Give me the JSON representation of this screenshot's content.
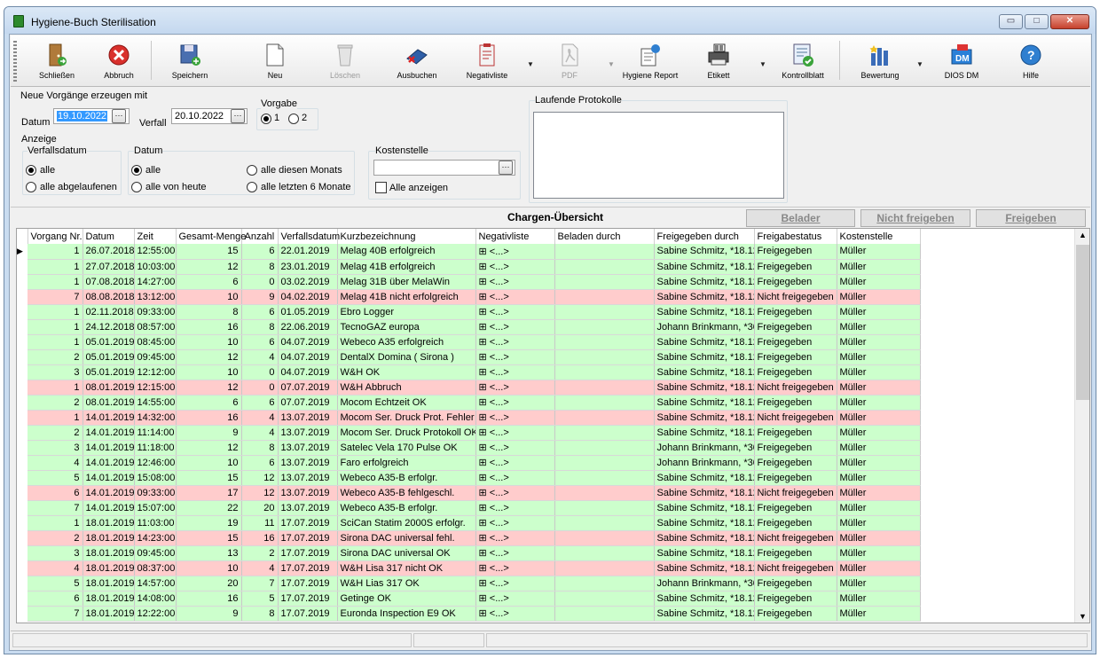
{
  "window": {
    "title": "Hygiene-Buch Sterilisation"
  },
  "toolbar": [
    {
      "label": "Schließen",
      "icon": "door-exit-icon",
      "x": "tb1"
    },
    {
      "label": "Abbruch",
      "icon": "cancel-icon"
    },
    {
      "label": "Speichern",
      "icon": "save-icon"
    },
    {
      "label": "Neu",
      "icon": "new-page-icon"
    },
    {
      "label": "Löschen",
      "icon": "delete-icon",
      "disabled": true
    },
    {
      "label": "Ausbuchen",
      "icon": "book-out-icon"
    },
    {
      "label": "Negativliste",
      "icon": "clipboard-icon"
    },
    {
      "label": "PDF",
      "icon": "pdf-icon",
      "disabled": true
    },
    {
      "label": "Hygiene Report",
      "icon": "report-icon"
    },
    {
      "label": "Etikett",
      "icon": "label-printer-icon"
    },
    {
      "label": "Kontrollblatt",
      "icon": "checklist-icon"
    },
    {
      "label": "Bewertung",
      "icon": "rating-icon"
    },
    {
      "label": "DIOS DM",
      "icon": "dios-icon"
    },
    {
      "label": "Hilfe",
      "icon": "help-icon"
    }
  ],
  "neue": {
    "heading": "Neue Vorgänge erzeugen mit",
    "datum_label": "Datum",
    "datum": "19.10.2022",
    "verfall_label": "Verfall",
    "verfall": "20.10.2022",
    "vorgabe_label": "Vorgabe",
    "opt1": "1",
    "opt2": "2"
  },
  "anzeige": {
    "heading": "Anzeige",
    "verfall_group": "Verfallsdatum",
    "v_alle": "alle",
    "v_abgelaufen": "alle abgelaufenen",
    "datum_group": "Datum",
    "d_alle": "alle",
    "d_heute": "alle von heute",
    "d_monat": "alle diesen Monats",
    "d_6monate": "alle letzten 6 Monate",
    "kst_group": "Kostenstelle",
    "alle_anzeigen": "Alle anzeigen"
  },
  "protokolle": {
    "heading": "Laufende Protokolle"
  },
  "grid": {
    "title": "Chargen-Übersicht",
    "btn_belader": "Belader",
    "btn_nicht": "Nicht freigeben",
    "btn_frei": "Freigeben",
    "columns": [
      "Vorgang Nr.",
      "Datum",
      "Zeit",
      "Gesamt-Menge",
      "Anzahl",
      "Verfallsdatum",
      "Kurzbezeichnung",
      "Negativliste",
      "Beladen durch",
      "Freigegeben durch",
      "Freigabestatus",
      "Kostenstelle"
    ],
    "rows": [
      [
        "1",
        "26.07.2018",
        "12:55:00",
        "15",
        "6",
        "22.01.2019",
        "Melag 40B erfolgreich",
        "⊞ <...>",
        "",
        "Sabine Schmitz, *18.12",
        "Freigegeben",
        "Müller"
      ],
      [
        "1",
        "27.07.2018",
        "10:03:00",
        "12",
        "8",
        "23.01.2019",
        "Melag 41B erfolgreich",
        "⊞ <...>",
        "",
        "Sabine Schmitz, *18.12",
        "Freigegeben",
        "Müller"
      ],
      [
        "1",
        "07.08.2018",
        "14:27:00",
        "6",
        "0",
        "03.02.2019",
        "Melag 31B über MelaWin",
        "⊞ <...>",
        "",
        "Sabine Schmitz, *18.12",
        "Freigegeben",
        "Müller"
      ],
      [
        "7",
        "08.08.2018",
        "13:12:00",
        "10",
        "9",
        "04.02.2019",
        "Melag 41B nicht erfolgreich",
        "⊞ <...>",
        "",
        "Sabine Schmitz, *18.12",
        "Nicht freigegeben",
        "Müller"
      ],
      [
        "1",
        "02.11.2018",
        "09:33:00",
        "8",
        "6",
        "01.05.2019",
        "Ebro Logger",
        "⊞ <...>",
        "",
        "Sabine Schmitz, *18.12",
        "Freigegeben",
        "Müller"
      ],
      [
        "1",
        "24.12.2018",
        "08:57:00",
        "16",
        "8",
        "22.06.2019",
        "TecnoGAZ europa",
        "⊞ <...>",
        "",
        "Johann Brinkmann, *30",
        "Freigegeben",
        "Müller"
      ],
      [
        "1",
        "05.01.2019",
        "08:45:00",
        "10",
        "6",
        "04.07.2019",
        "Webeco A35 erfolgreich",
        "⊞ <...>",
        "",
        "Sabine Schmitz, *18.12",
        "Freigegeben",
        "Müller"
      ],
      [
        "2",
        "05.01.2019",
        "09:45:00",
        "12",
        "4",
        "04.07.2019",
        "DentalX Domina ( Sirona )",
        "⊞ <...>",
        "",
        "Sabine Schmitz, *18.12",
        "Freigegeben",
        "Müller"
      ],
      [
        "3",
        "05.01.2019",
        "12:12:00",
        "10",
        "0",
        "04.07.2019",
        "W&H OK",
        "⊞ <...>",
        "",
        "Sabine Schmitz, *18.12",
        "Freigegeben",
        "Müller"
      ],
      [
        "1",
        "08.01.2019",
        "12:15:00",
        "12",
        "0",
        "07.07.2019",
        "W&H Abbruch",
        "⊞ <...>",
        "",
        "Sabine Schmitz, *18.12",
        "Nicht freigegeben",
        "Müller"
      ],
      [
        "2",
        "08.01.2019",
        "14:55:00",
        "6",
        "6",
        "07.07.2019",
        "Mocom Echtzeit OK",
        "⊞ <...>",
        "",
        "Sabine Schmitz, *18.12",
        "Freigegeben",
        "Müller"
      ],
      [
        "1",
        "14.01.2019",
        "14:32:00",
        "16",
        "4",
        "13.07.2019",
        "Mocom Ser. Druck Prot. Fehler",
        "⊞ <...>",
        "",
        "Sabine Schmitz, *18.12",
        "Nicht freigegeben",
        "Müller"
      ],
      [
        "2",
        "14.01.2019",
        "11:14:00",
        "9",
        "4",
        "13.07.2019",
        "Mocom Ser. Druck Protokoll OK",
        "⊞ <...>",
        "",
        "Sabine Schmitz, *18.12",
        "Freigegeben",
        "Müller"
      ],
      [
        "3",
        "14.01.2019",
        "11:18:00",
        "12",
        "8",
        "13.07.2019",
        "Satelec Vela 170 Pulse OK",
        "⊞ <...>",
        "",
        "Johann Brinkmann, *30",
        "Freigegeben",
        "Müller"
      ],
      [
        "4",
        "14.01.2019",
        "12:46:00",
        "10",
        "6",
        "13.07.2019",
        "Faro erfolgreich",
        "⊞ <...>",
        "",
        "Johann Brinkmann, *30",
        "Freigegeben",
        "Müller"
      ],
      [
        "5",
        "14.01.2019",
        "15:08:00",
        "15",
        "12",
        "13.07.2019",
        "Webeco A35-B erfolgr.",
        "⊞ <...>",
        "",
        "Sabine Schmitz, *18.12",
        "Freigegeben",
        "Müller"
      ],
      [
        "6",
        "14.01.2019",
        "09:33:00",
        "17",
        "12",
        "13.07.2019",
        "Webeco A35-B fehlgeschl.",
        "⊞ <...>",
        "",
        "Sabine Schmitz, *18.12",
        "Nicht freigegeben",
        "Müller"
      ],
      [
        "7",
        "14.01.2019",
        "15:07:00",
        "22",
        "20",
        "13.07.2019",
        "Webeco A35-B erfolgr.",
        "⊞ <...>",
        "",
        "Sabine Schmitz, *18.12",
        "Freigegeben",
        "Müller"
      ],
      [
        "1",
        "18.01.2019",
        "11:03:00",
        "19",
        "11",
        "17.07.2019",
        "SciCan Statim 2000S erfolgr.",
        "⊞ <...>",
        "",
        "Sabine Schmitz, *18.12",
        "Freigegeben",
        "Müller"
      ],
      [
        "2",
        "18.01.2019",
        "14:23:00",
        "15",
        "16",
        "17.07.2019",
        "Sirona DAC universal fehl.",
        "⊞ <...>",
        "",
        "Sabine Schmitz, *18.12",
        "Nicht freigegeben",
        "Müller"
      ],
      [
        "3",
        "18.01.2019",
        "09:45:00",
        "13",
        "2",
        "17.07.2019",
        "Sirona DAC universal OK",
        "⊞ <...>",
        "",
        "Sabine Schmitz, *18.12",
        "Freigegeben",
        "Müller"
      ],
      [
        "4",
        "18.01.2019",
        "08:37:00",
        "10",
        "4",
        "17.07.2019",
        "W&H Lisa 317 nicht OK",
        "⊞ <...>",
        "",
        "Sabine Schmitz, *18.12",
        "Nicht freigegeben",
        "Müller"
      ],
      [
        "5",
        "18.01.2019",
        "14:57:00",
        "20",
        "7",
        "17.07.2019",
        "W&H Lias 317 OK",
        "⊞ <...>",
        "",
        "Johann Brinkmann, *30",
        "Freigegeben",
        "Müller"
      ],
      [
        "6",
        "18.01.2019",
        "14:08:00",
        "16",
        "5",
        "17.07.2019",
        "Getinge OK",
        "⊞ <...>",
        "",
        "Sabine Schmitz, *18.12",
        "Freigegeben",
        "Müller"
      ],
      [
        "7",
        "18.01.2019",
        "12:22:00",
        "9",
        "8",
        "17.07.2019",
        "Euronda Inspection E9 OK",
        "⊞ <...>",
        "",
        "Sabine Schmitz, *18.12",
        "Freigegeben",
        "Müller"
      ]
    ]
  }
}
